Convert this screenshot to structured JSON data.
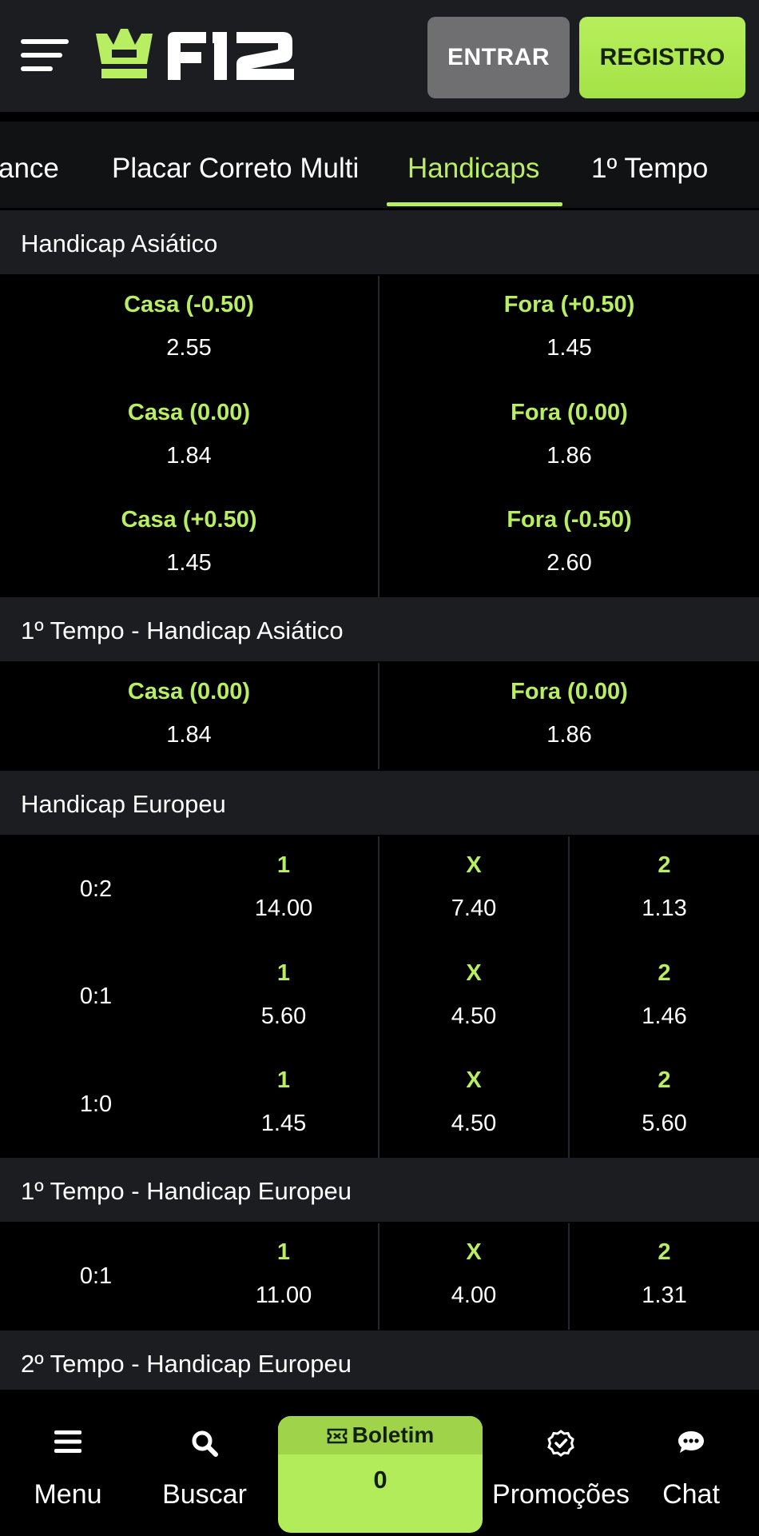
{
  "header": {
    "logo_text": "F12",
    "entrar_label": "ENTRAR",
    "registro_label": "REGISTRO"
  },
  "tabs": [
    {
      "label": "ance"
    },
    {
      "label": "Placar Correto Multi"
    },
    {
      "label": "Handicaps",
      "active": true
    },
    {
      "label": "1º Tempo"
    }
  ],
  "markets": {
    "asian": {
      "title": "Handicap Asiático",
      "rows": [
        {
          "home_label": "Casa (-0.50)",
          "home_odd": "2.55",
          "away_label": "Fora (+0.50)",
          "away_odd": "1.45"
        },
        {
          "home_label": "Casa (0.00)",
          "home_odd": "1.84",
          "away_label": "Fora (0.00)",
          "away_odd": "1.86"
        },
        {
          "home_label": "Casa (+0.50)",
          "home_odd": "1.45",
          "away_label": "Fora (-0.50)",
          "away_odd": "2.60"
        }
      ]
    },
    "asian_1t": {
      "title": "1º Tempo - Handicap Asiático",
      "rows": [
        {
          "home_label": "Casa (0.00)",
          "home_odd": "1.84",
          "away_label": "Fora (0.00)",
          "away_odd": "1.86"
        }
      ]
    },
    "european": {
      "title": "Handicap Europeu",
      "rows": [
        {
          "line": "0:2",
          "l1": "1",
          "o1": "14.00",
          "lx": "X",
          "ox": "7.40",
          "l2": "2",
          "o2": "1.13"
        },
        {
          "line": "0:1",
          "l1": "1",
          "o1": "5.60",
          "lx": "X",
          "ox": "4.50",
          "l2": "2",
          "o2": "1.46"
        },
        {
          "line": "1:0",
          "l1": "1",
          "o1": "1.45",
          "lx": "X",
          "ox": "4.50",
          "l2": "2",
          "o2": "5.60"
        }
      ]
    },
    "european_1t": {
      "title": "1º Tempo - Handicap Europeu",
      "rows": [
        {
          "line": "0:1",
          "l1": "1",
          "o1": "11.00",
          "lx": "X",
          "ox": "4.00",
          "l2": "2",
          "o2": "1.31"
        }
      ]
    },
    "european_2t": {
      "title": "2º Tempo - Handicap Europeu"
    }
  },
  "bottom_nav": {
    "menu_label": "Menu",
    "buscar_label": "Buscar",
    "boletim_label": "Boletim",
    "boletim_count": "0",
    "promocoes_label": "Promoções",
    "chat_label": "Chat"
  },
  "colors": {
    "accent": "#b8ee62",
    "header_bg": "#1b1d21",
    "page_bg": "#000000",
    "entrar_bg": "#6f6f72"
  },
  "icons": [
    "hamburger-icon",
    "crown-icon",
    "menu-icon",
    "search-icon",
    "ticket-icon",
    "check-circle-icon",
    "chat-bubble-icon"
  ]
}
